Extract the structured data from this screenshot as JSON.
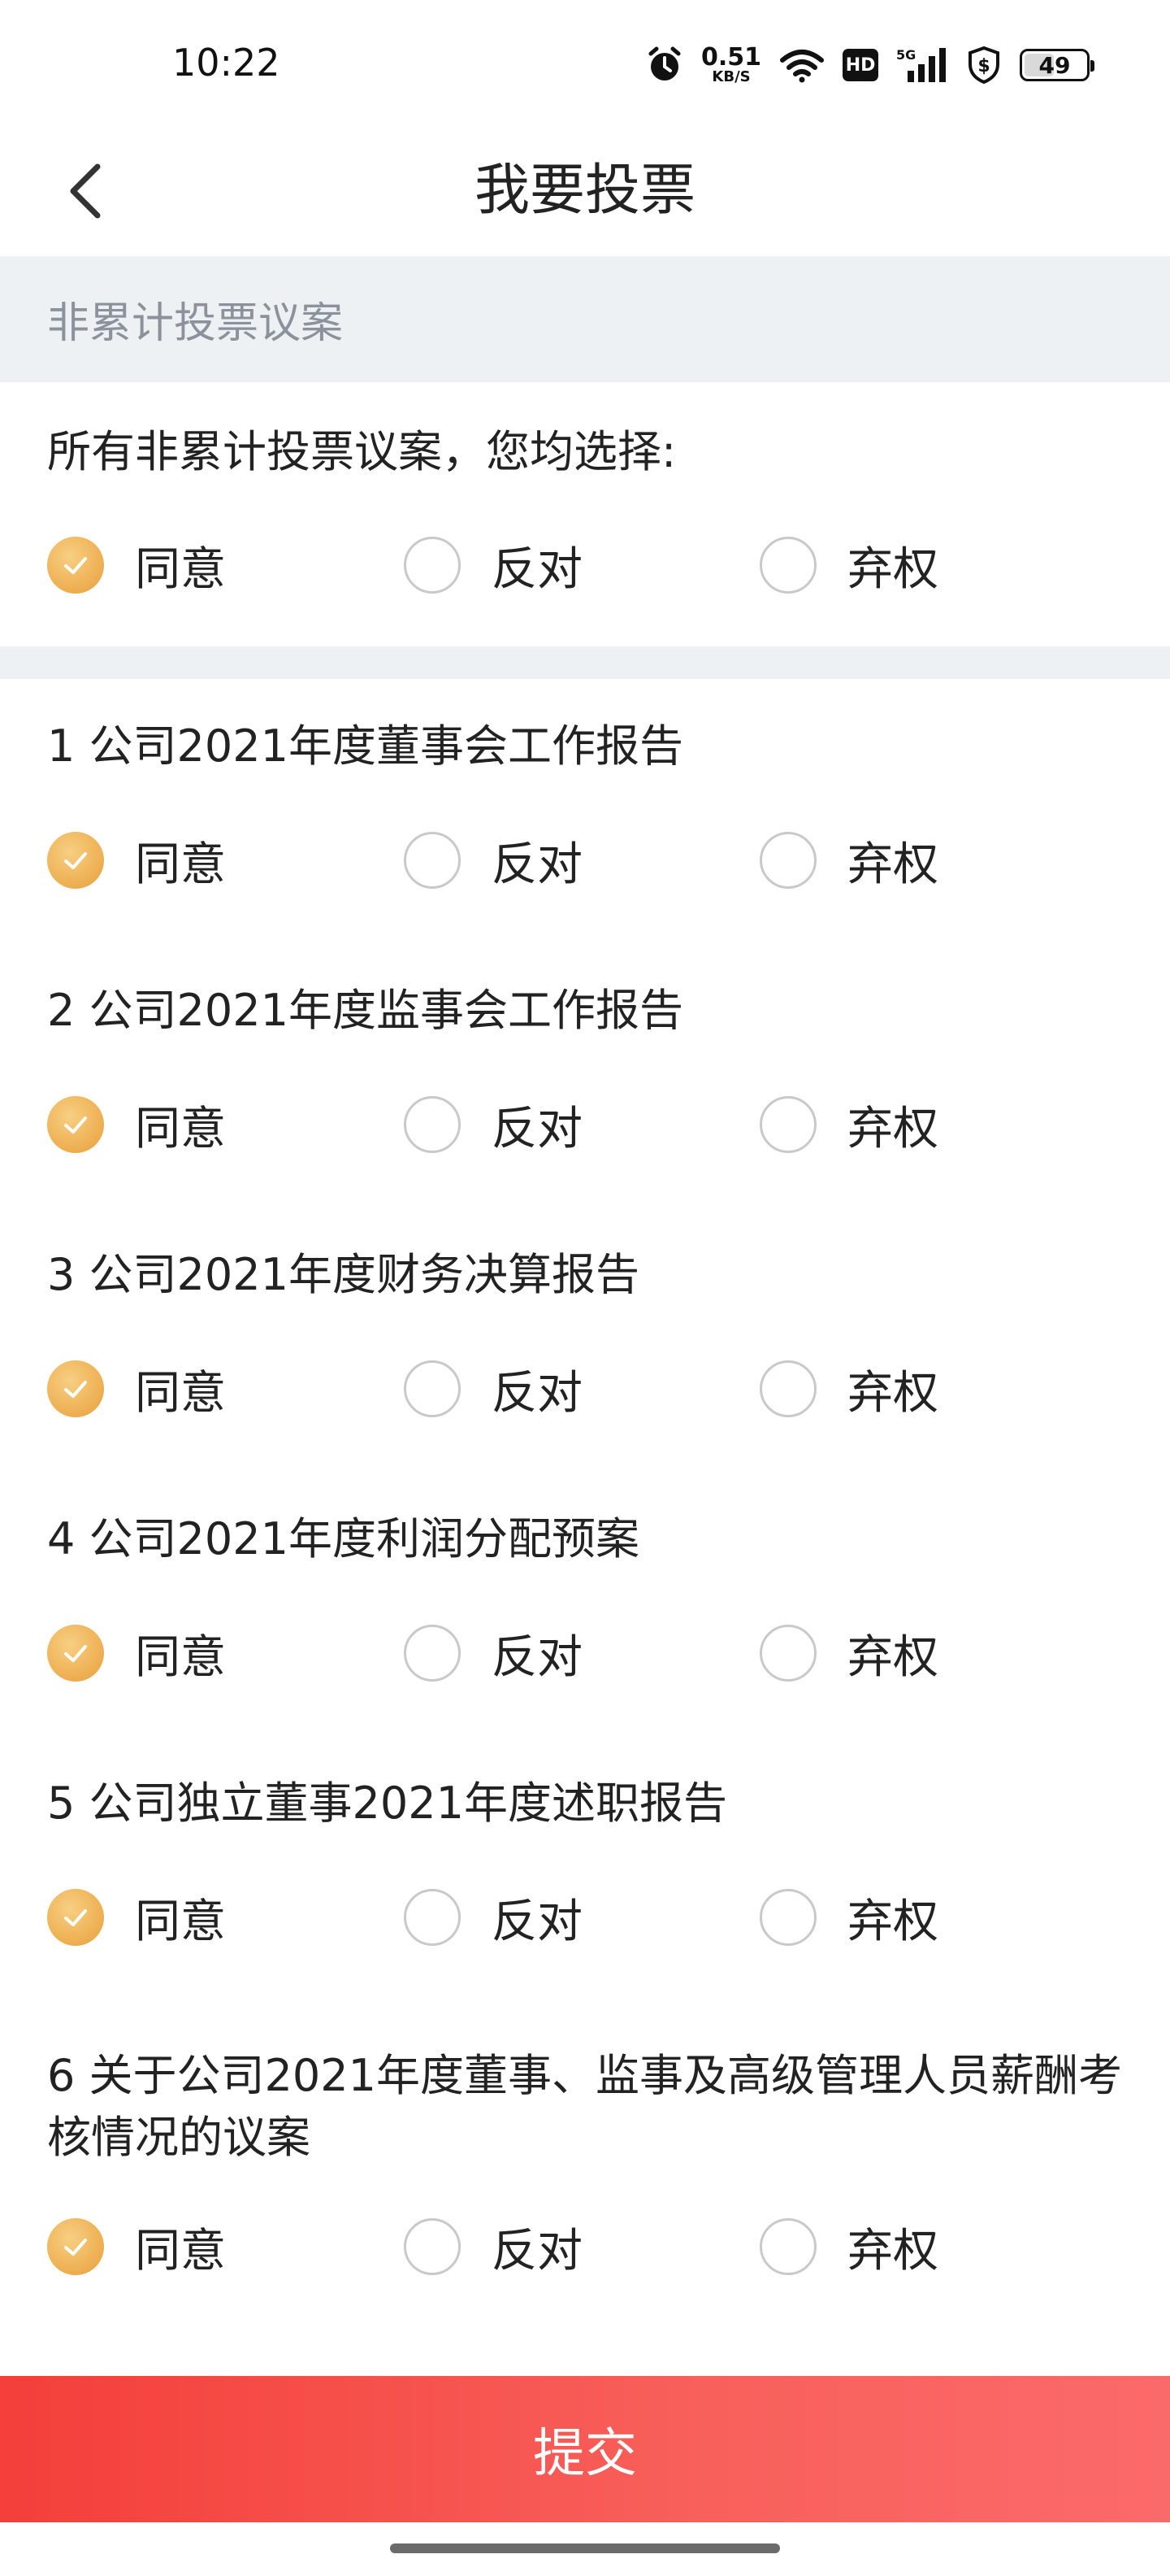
{
  "status_bar": {
    "time": "10:22",
    "net_speed_value": "0.51",
    "net_speed_unit": "KB/S",
    "hd_label": "HD",
    "network_label": "5G",
    "battery_percent": 49,
    "battery_text": "49"
  },
  "header": {
    "title": "我要投票"
  },
  "section": {
    "title": "非累计投票议案"
  },
  "bulk": {
    "prompt": "所有非累计投票议案，您均选择:"
  },
  "options": {
    "agree": "同意",
    "oppose": "反对",
    "abstain": "弃权"
  },
  "items": [
    {
      "title": "1 公司2021年度董事会工作报告",
      "selected": "agree"
    },
    {
      "title": "2 公司2021年度监事会工作报告",
      "selected": "agree"
    },
    {
      "title": "3 公司2021年度财务决算报告",
      "selected": "agree"
    },
    {
      "title": "4 公司2021年度利润分配预案",
      "selected": "agree"
    },
    {
      "title": "5 公司独立董事2021年度述职报告",
      "selected": "agree"
    },
    {
      "title": "6 关于公司2021年度董事、监事及高级管理人员薪酬考核情况的议案",
      "selected": "agree"
    }
  ],
  "footer": {
    "submit_label": "提交"
  },
  "colors": {
    "accent_check": "#efb256",
    "submit_start": "#f43f3a",
    "submit_end": "#fb6a6a",
    "section_bg": "#eef1f4"
  }
}
